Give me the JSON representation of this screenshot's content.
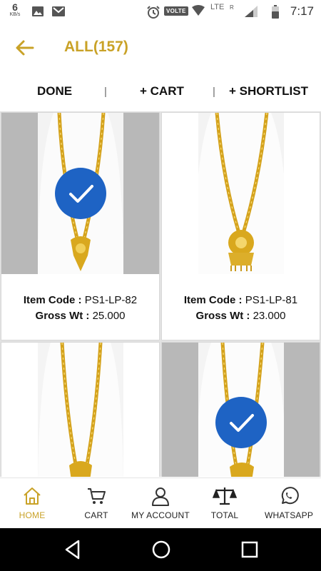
{
  "status_bar": {
    "speed_value": "6",
    "speed_unit": "KB/s",
    "network": "LTE",
    "volte": "VOLTE",
    "roaming": "R",
    "time": "7:17"
  },
  "header": {
    "back_icon": "arrow-left-icon",
    "title": "ALL(157)"
  },
  "actions": {
    "done": "DONE",
    "cart": "+ CART",
    "shortlist": "+ SHORTLIST",
    "separator": "|"
  },
  "products": [
    {
      "item_code_label": "Item Code :",
      "item_code": "PS1-LP-82",
      "gross_label": "Gross Wt :",
      "gross_wt": "25.000",
      "selected": true
    },
    {
      "item_code_label": "Item Code :",
      "item_code": "PS1-LP-81",
      "gross_label": "Gross Wt :",
      "gross_wt": "23.000",
      "selected": false
    },
    {
      "selected": false
    },
    {
      "selected": true
    }
  ],
  "bottom_nav": [
    {
      "label": "HOME",
      "icon": "home-icon",
      "active": true
    },
    {
      "label": "CART",
      "icon": "cart-icon",
      "active": false
    },
    {
      "label": "MY ACCOUNT",
      "icon": "user-icon",
      "active": false
    },
    {
      "label": "TOTAL",
      "icon": "scale-icon",
      "active": false
    },
    {
      "label": "WHATSAPP",
      "icon": "whatsapp-icon",
      "active": false
    }
  ],
  "colors": {
    "accent": "#c9a227",
    "check": "#1e63c4",
    "selected_bg": "#b8b8b8"
  }
}
